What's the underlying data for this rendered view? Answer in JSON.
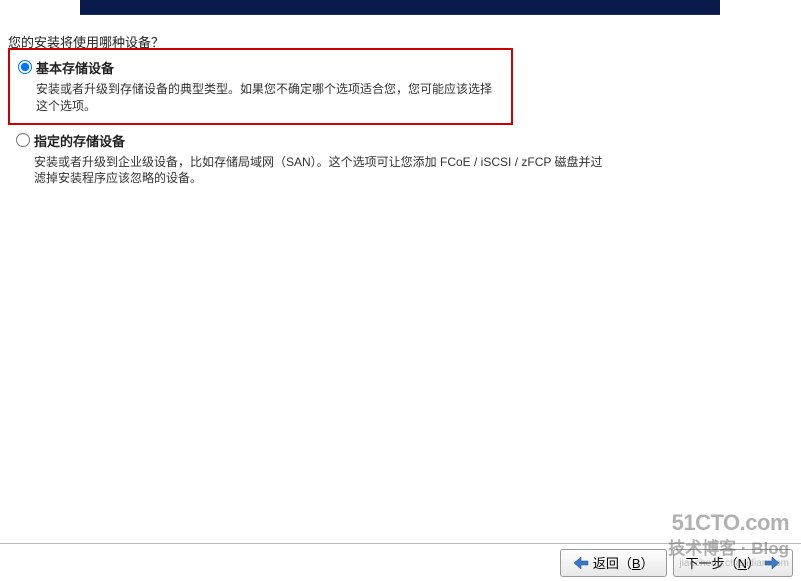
{
  "prompt": "您的安装将使用哪种设备？",
  "options": [
    {
      "title": "基本存储设备",
      "desc": "安装或者升级到存储设备的典型类型。如果您不确定哪个选项适合您，您可能应该选择这个选项。"
    },
    {
      "title": "指定的存储设备",
      "desc": "安装或者升级到企业级设备，比如存储局域网（SAN）。这个选项可让您添加 FCoE / iSCSI / zFCP 磁盘并过滤掉安装程序应该忽略的设备。"
    }
  ],
  "nav": {
    "back_prefix": "返回（",
    "back_key": "B",
    "back_suffix": "）",
    "next_prefix": "下一步（",
    "next_key": "N",
    "next_suffix": "）"
  },
  "watermark": {
    "top": "51CTO.com",
    "mid": "技术博客 · Blog",
    "bot": "jiaocheng.chazidian.com"
  }
}
